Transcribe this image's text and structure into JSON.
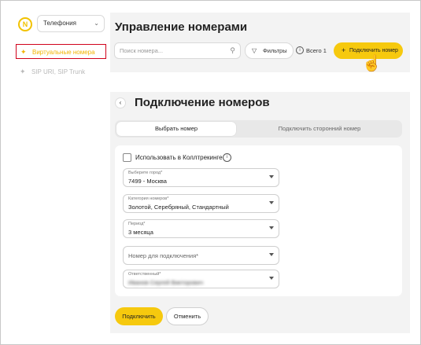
{
  "sidebar": {
    "logo_letter": "N",
    "product_select": {
      "value": "Телефония"
    },
    "items": [
      {
        "label": "Виртуальные номера",
        "active": true,
        "icon": "phone-sparkle-icon"
      },
      {
        "label": "SIP URI, SIP Trunk",
        "active": false,
        "icon": "sparkle-icon"
      }
    ]
  },
  "header": {
    "title": "Управление номерами",
    "search_placeholder": "Поиск номера...",
    "filters_label": "Фильтры",
    "total_label": "Всего 1",
    "connect_label": "Подключить номер"
  },
  "panel": {
    "title": "Подключение номеров",
    "tabs": [
      {
        "label": "Выбрать номер",
        "active": true
      },
      {
        "label": "Подключить сторонний номер",
        "active": false
      }
    ],
    "calltracking_label": "Использовать в Коллтрекинге",
    "fields": {
      "city": {
        "label": "Выберите город*",
        "value": "7499 - Москва"
      },
      "category": {
        "label": "Категория номеров*",
        "value": "Золотой, Серебряный, Стандартный"
      },
      "period": {
        "label": "Период*",
        "value": "3 месяца"
      },
      "number": {
        "placeholder": "Номер для подключения*"
      },
      "responsible": {
        "label": "Ответственный*",
        "value": "Иванов Сергей Викторович"
      }
    },
    "submit_label": "Подключить",
    "cancel_label": "Отменить"
  },
  "colors": {
    "accent": "#f6c90e",
    "active_nav_text": "#f2b400",
    "highlight_border": "#d0021b",
    "panel_bg": "#f3f3f3"
  }
}
